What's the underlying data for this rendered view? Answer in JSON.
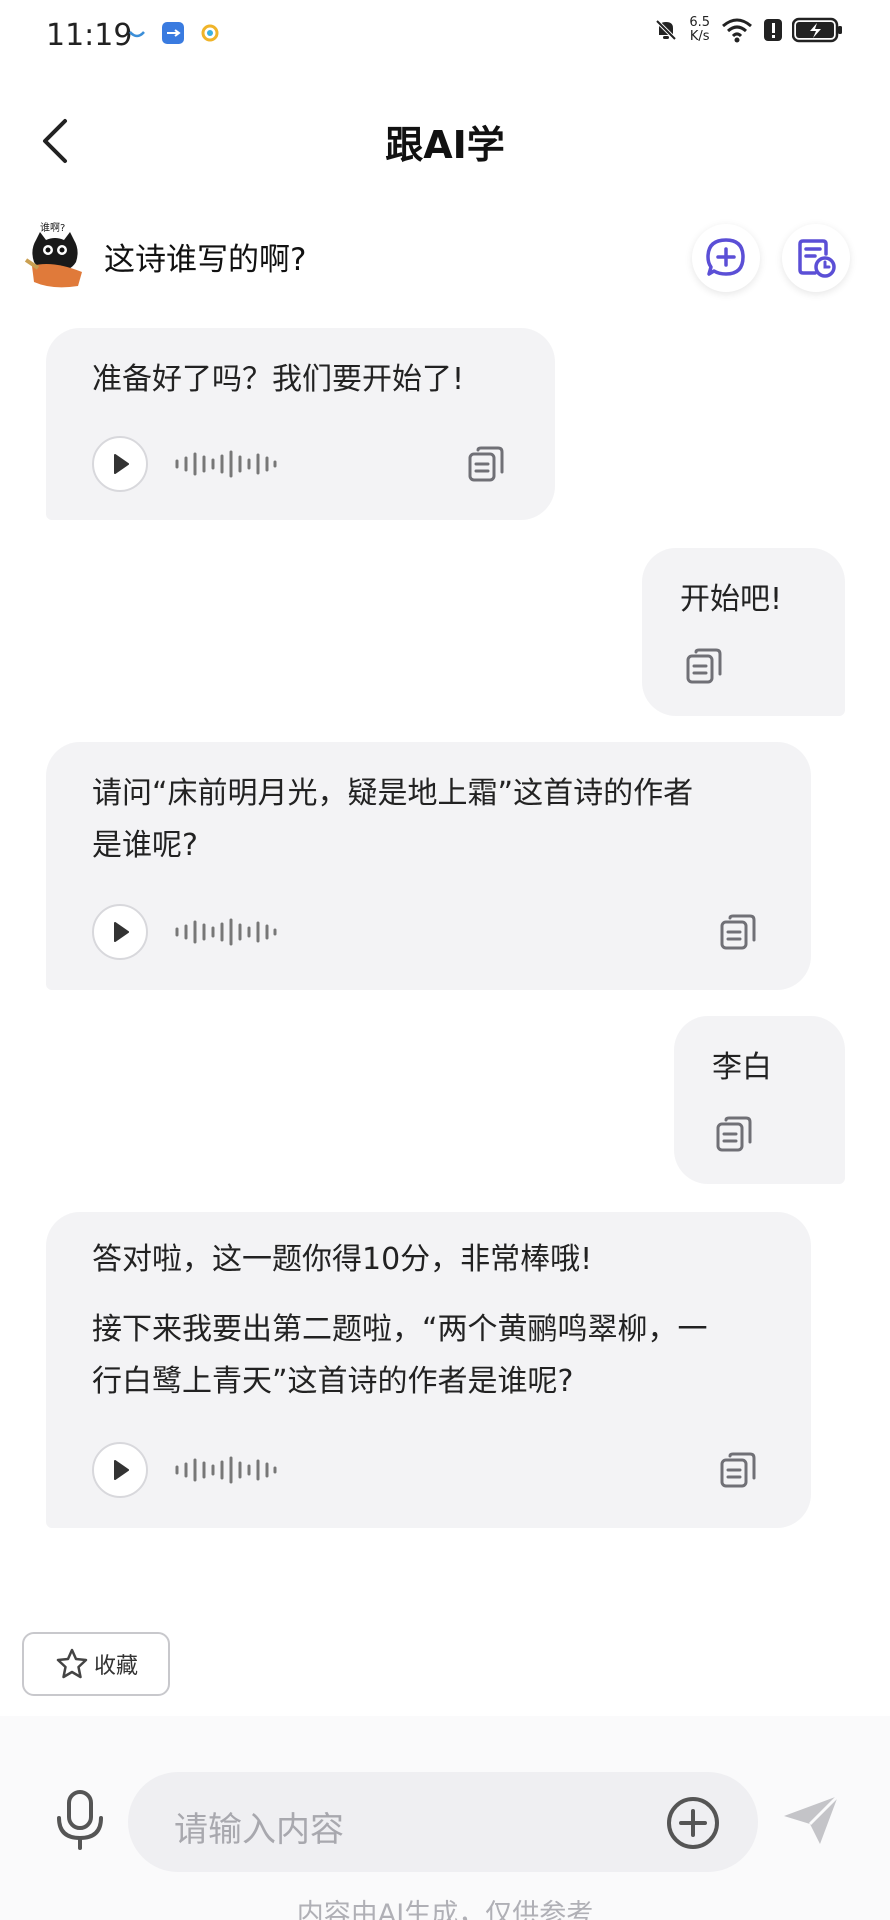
{
  "status_bar": {
    "time": "11:19",
    "net_speed_value": "6.5",
    "net_speed_unit": "K/s"
  },
  "header": {
    "title": "跟AI学"
  },
  "topic": {
    "avatar_text": "谁啊?",
    "text": "这诗谁写的啊?"
  },
  "messages": [
    {
      "role": "ai",
      "lines": [
        "准备好了吗？我们要开始了!"
      ]
    },
    {
      "role": "user",
      "lines": [
        "开始吧!"
      ]
    },
    {
      "role": "ai",
      "lines": [
        "请问“床前明月光，疑是地上霜”这首诗的作者",
        "是谁呢?"
      ]
    },
    {
      "role": "user",
      "lines": [
        "李白"
      ]
    },
    {
      "role": "ai",
      "lines": [
        "答对啦，这一题你得10分，非常棒哦!",
        "接下来我要出第二题啦，“两个黄鹂鸣翠柳，一",
        "行白鹭上青天”这首诗的作者是谁呢?"
      ]
    }
  ],
  "favorite": {
    "label": "收藏"
  },
  "input": {
    "placeholder": "请输入内容"
  },
  "footer": {
    "note": "内容由AI生成，仅供参考"
  },
  "colors": {
    "accent": "#5b4fd6",
    "bubble_bg": "#f3f3f5",
    "icon_gray": "#6e6e74"
  }
}
